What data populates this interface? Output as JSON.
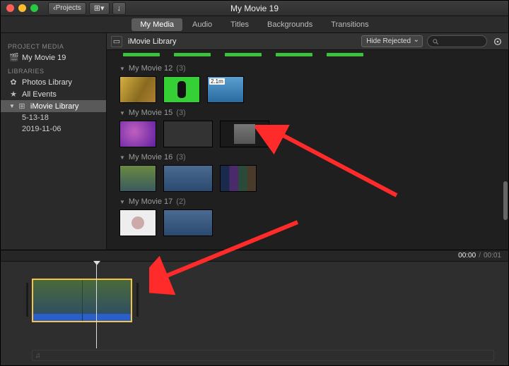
{
  "window": {
    "title": "My Movie 19"
  },
  "toolbar": {
    "back_label": "Projects"
  },
  "tabs": [
    {
      "label": "My Media",
      "active": true
    },
    {
      "label": "Audio"
    },
    {
      "label": "Titles"
    },
    {
      "label": "Backgrounds"
    },
    {
      "label": "Transitions"
    }
  ],
  "sidebar": {
    "section_project": "PROJECT MEDIA",
    "project_name": "My Movie 19",
    "section_libraries": "LIBRARIES",
    "items": [
      {
        "icon": "✿",
        "label": "Photos Library"
      },
      {
        "icon": "★",
        "label": "All Events"
      },
      {
        "icon": "⊞",
        "label": "iMovie Library",
        "selected": true
      },
      {
        "label": "5-13-18",
        "sub": true
      },
      {
        "label": "2019-11-06",
        "sub": true
      }
    ]
  },
  "browser": {
    "library_title": "iMovie Library",
    "filter_label": "Hide Rejected",
    "events": [
      {
        "title": "My Movie 12",
        "count": "(3)",
        "thumbs": [
          "tx1",
          "tx2",
          "tx3"
        ],
        "badge": [
          "",
          "",
          "2.1m"
        ]
      },
      {
        "title": "My Movie 15",
        "count": "(3)",
        "thumbs": [
          "tx4",
          "tx5|tx6",
          "tx7"
        ],
        "wide": [
          false,
          true,
          true
        ]
      },
      {
        "title": "My Movie 16",
        "count": "(3)",
        "thumbs": [
          "tx8",
          "tx9",
          "tx10"
        ],
        "wide": [
          false,
          true,
          false
        ]
      },
      {
        "title": "My Movie 17",
        "count": "(2)",
        "thumbs": [
          "tx11",
          "tx9"
        ],
        "wide": [
          false,
          true
        ]
      }
    ]
  },
  "timeline": {
    "current": "00:00",
    "separator": "/",
    "total": "00:01",
    "music_symbol": "♫"
  }
}
